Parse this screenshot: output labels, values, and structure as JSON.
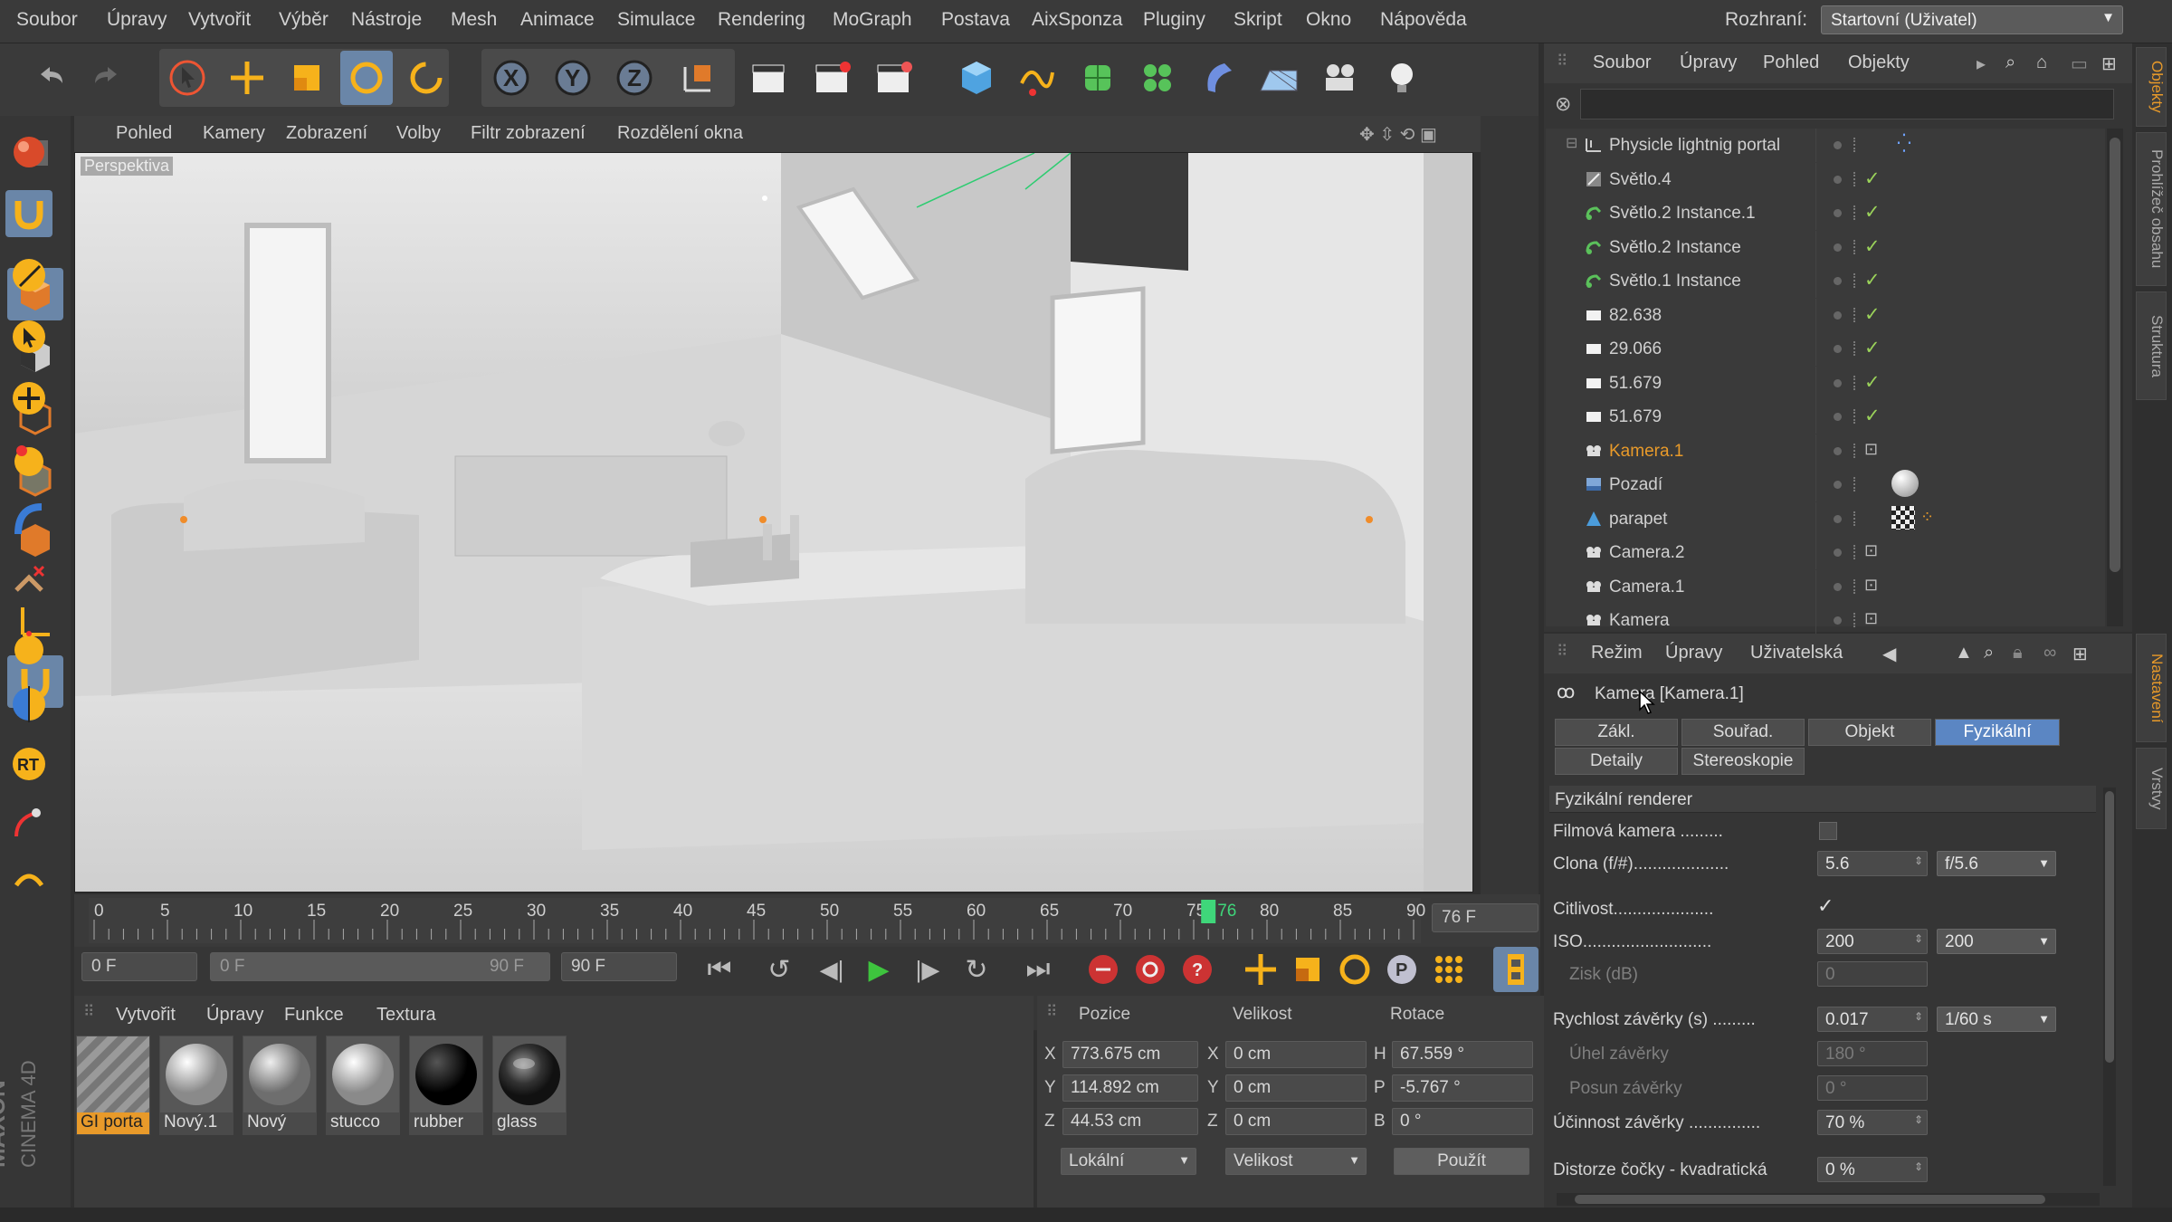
{
  "menubar": {
    "items": [
      "Soubor",
      "Úpravy",
      "Vytvořit",
      "Výběr",
      "Nástroje",
      "Mesh",
      "Animace",
      "Simulace",
      "Rendering",
      "MoGraph",
      "Postava",
      "AixSponza",
      "Pluginy",
      "Skript",
      "Okno",
      "Nápověda"
    ],
    "interface_label": "Rozhraní:",
    "interface_value": "Startovní (Uživatel)"
  },
  "viewport": {
    "menu": [
      "Pohled",
      "Kamery",
      "Zobrazení",
      "Volby",
      "Filtr zobrazení",
      "Rozdělení okna"
    ],
    "view_name": "Perspektiva"
  },
  "timeline": {
    "ticks": [
      "0",
      "5",
      "10",
      "15",
      "20",
      "25",
      "30",
      "35",
      "40",
      "45",
      "50",
      "55",
      "60",
      "65",
      "70",
      "75",
      "80",
      "85",
      "90"
    ],
    "current_frame": 76,
    "current_frame_label": "76",
    "frame_field": "76 F"
  },
  "transport": {
    "start_frame": "0 F",
    "range_start": "0 F",
    "range_end": "90 F",
    "end_frame": "90 F"
  },
  "materials": {
    "menu": [
      "Vytvořit",
      "Úpravy",
      "Funkce",
      "Textura"
    ],
    "items": [
      {
        "name": "GI porta",
        "type": "stripes"
      },
      {
        "name": "Nový.1",
        "type": "white"
      },
      {
        "name": "Nový",
        "type": "grey"
      },
      {
        "name": "stucco",
        "type": "white"
      },
      {
        "name": "rubber",
        "type": "black"
      },
      {
        "name": "glass",
        "type": "glass"
      }
    ]
  },
  "coordinates": {
    "headers": [
      "Pozice",
      "Velikost",
      "Rotace"
    ],
    "rows": [
      {
        "axis": "X",
        "pos": "773.675 cm",
        "size_axis": "X",
        "size": "0 cm",
        "rot_axis": "H",
        "rot": "67.559 °"
      },
      {
        "axis": "Y",
        "pos": "114.892 cm",
        "size_axis": "Y",
        "size": "0 cm",
        "rot_axis": "P",
        "rot": "-5.767 °"
      },
      {
        "axis": "Z",
        "pos": "44.53 cm",
        "size_axis": "Z",
        "size": "0 cm",
        "rot_axis": "B",
        "rot": "0 °"
      }
    ],
    "mode": "Lokální",
    "size_mode": "Velikost",
    "apply": "Použít"
  },
  "objects": {
    "menu": [
      "Soubor",
      "Úpravy",
      "Pohled",
      "Objekty"
    ],
    "rows": [
      {
        "name": "Physicle lightnig portal",
        "icon": "layer-icon",
        "check": false,
        "highlight": false
      },
      {
        "name": "Světlo.4",
        "icon": "light-icon",
        "check": true,
        "highlight": false
      },
      {
        "name": "Světlo.2 Instance.1",
        "icon": "instance-icon",
        "check": true,
        "highlight": false
      },
      {
        "name": "Světlo.2 Instance",
        "icon": "instance-icon",
        "check": true,
        "highlight": false
      },
      {
        "name": "Světlo.1 Instance",
        "icon": "instance-icon",
        "check": true,
        "highlight": false
      },
      {
        "name": "82.638",
        "icon": "plane-icon",
        "check": true,
        "highlight": false
      },
      {
        "name": "29.066",
        "icon": "plane-icon",
        "check": true,
        "highlight": false
      },
      {
        "name": "51.679",
        "icon": "plane-icon",
        "check": true,
        "highlight": false
      },
      {
        "name": "51.679",
        "icon": "plane-icon",
        "check": true,
        "highlight": false
      },
      {
        "name": "Kamera.1",
        "icon": "camera-icon",
        "check": false,
        "highlight": true
      },
      {
        "name": "Pozadí",
        "icon": "background-icon",
        "check": false,
        "highlight": false
      },
      {
        "name": "parapet",
        "icon": "null-icon",
        "check": false,
        "highlight": false
      },
      {
        "name": "Camera.2",
        "icon": "camera-icon",
        "check": false,
        "highlight": false
      },
      {
        "name": "Camera.1",
        "icon": "camera-icon",
        "check": false,
        "highlight": false
      },
      {
        "name": "Kamera",
        "icon": "camera-icon",
        "check": false,
        "highlight": false
      }
    ]
  },
  "attributes": {
    "menu": [
      "Režim",
      "Úpravy",
      "Uživatelská"
    ],
    "title": "Kamera [Kamera.1]",
    "tabs_row1": [
      "Zákl.",
      "Souřad.",
      "Objekt",
      "Fyzikální"
    ],
    "tabs_row2": [
      "Detaily",
      "Stereoskopie"
    ],
    "active_tab": "Fyzikální",
    "section": "Fyzikální renderer",
    "film_camera": "Filmová kamera .........",
    "aperture_label": "Clona (f/#)....................",
    "aperture_value": "5.6",
    "aperture_preset": "f/5.6",
    "sensitivity_label": "Citlivost.....................",
    "iso_label": "ISO...........................",
    "iso_value": "200",
    "iso_preset": "200",
    "gain_label": "Zisk (dB)",
    "gain_value": "0",
    "shutter_label": "Rychlost závěrky (s) .........",
    "shutter_value": "0.017",
    "shutter_preset": "1/60 s",
    "shutter_angle_label": "Úhel závěrky",
    "shutter_angle_value": "180 °",
    "shutter_offset_label": "Posun závěrky",
    "shutter_offset_value": "0 °",
    "shutter_eff_label": "Účinnost závěrky ...............",
    "shutter_eff_value": "70 %",
    "distortion_label": "Distorze čočky - kvadratická",
    "distortion_value": "0 %"
  },
  "side_tabs": [
    "Objekty",
    "Prohlížeč obsahu",
    "Struktura",
    "Nastavení",
    "Vrstvy"
  ],
  "brand": {
    "line1": "MAXON",
    "line2": "CINEMA 4D"
  },
  "colors": {
    "accent": "#5b86c3",
    "highlight": "#e89a2a",
    "check": "#9ad25a"
  }
}
